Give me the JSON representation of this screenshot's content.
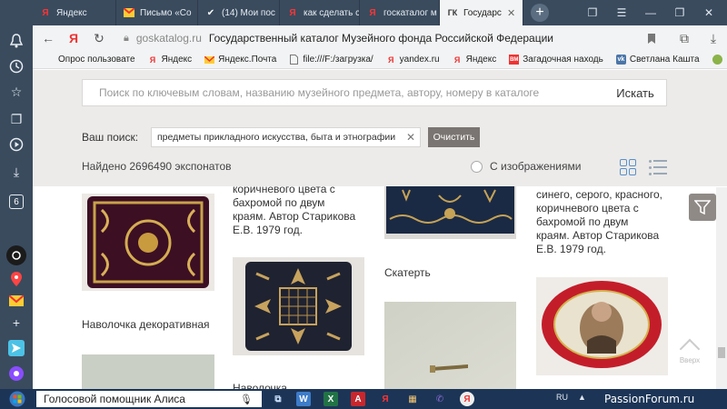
{
  "browser": {
    "tabs": [
      {
        "label": "Яндекс",
        "icon": "yandex-icon"
      },
      {
        "label": "Письмо «Со",
        "icon": "mail-icon"
      },
      {
        "label": "(14) Мои пос",
        "icon": "ok-icon"
      },
      {
        "label": "как сделать с",
        "icon": "yandex-icon"
      },
      {
        "label": "госкаталог м",
        "icon": "yandex-icon"
      },
      {
        "label": "Государс",
        "icon": "gk-icon",
        "fav_text": "ГК"
      }
    ],
    "address_domain": "goskatalog.ru",
    "page_title": "Государственный каталог Музейного фонда Российской Федерации",
    "side_badge": "6"
  },
  "bookmarks": [
    {
      "label": "Опрос пользовате",
      "icon": "none"
    },
    {
      "label": "Яндекс",
      "icon": "yandex-icon"
    },
    {
      "label": "Яндекс.Почта",
      "icon": "mail-icon"
    },
    {
      "label": "file:///F:/загрузка/",
      "icon": "file-icon"
    },
    {
      "label": "yandex.ru",
      "icon": "yandex-icon"
    },
    {
      "label": "Яндекс",
      "icon": "yandex-icon"
    },
    {
      "label": "Загадочная находь",
      "icon": "news-icon"
    },
    {
      "label": "Светлана Кашта",
      "icon": "vk-icon"
    }
  ],
  "search": {
    "placeholder": "Поиск по ключевым словам, названию музейного предмета, автору, номеру в каталоге",
    "button": "Искать",
    "your_search_label": "Ваш поиск:",
    "query_chip": "предметы прикладного искусства, быта и этнографии",
    "clear_button": "Очистить",
    "found_text": "Найдено 2696490 экспонатов",
    "with_images_label": "С изображениями"
  },
  "results": {
    "col2_top_text": [
      "коричневого цвета с",
      "бахромой по двум",
      "краям. Автор Старикова",
      "Е.В. 1979 год."
    ],
    "col1_caption": "Наволочка декоративная",
    "col2_caption": "Наволочка",
    "col3_caption": "Скатерть",
    "col4_top_text": [
      "синего, серого, красного,",
      "коричневого цвета с",
      "бахромой по двум",
      "краям. Автор Старикова",
      "Е.В. 1979 год."
    ]
  },
  "up_button_label": "Вверх",
  "taskbar": {
    "alice_label": "Голосовой помощник Алиса",
    "lang": "RU"
  },
  "watermark": "PassionForum.ru",
  "colors": {
    "browser_chrome": "#3a4b5e",
    "search_area_bg": "#ecebea",
    "clear_button": "#7a7572",
    "taskbar": "#1c3557",
    "accent_blue": "#5a8fc7"
  }
}
